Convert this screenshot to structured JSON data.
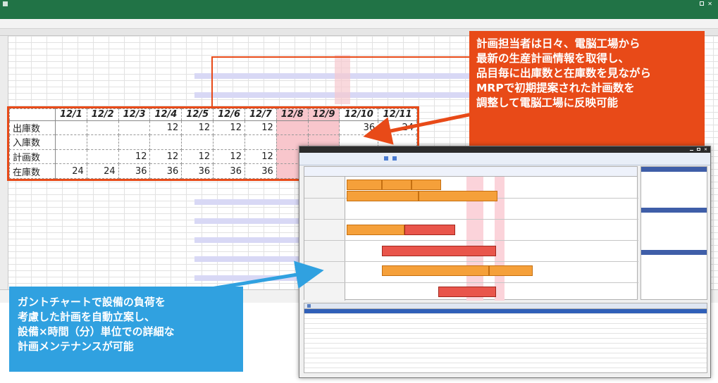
{
  "zoom_table": {
    "dates": [
      "12/1",
      "12/2",
      "12/3",
      "12/4",
      "12/5",
      "12/6",
      "12/7",
      "12/8",
      "12/9",
      "12/10",
      "12/11"
    ],
    "rows": [
      {
        "label": "出庫数",
        "values": [
          "",
          "",
          "",
          "12",
          "12",
          "12",
          "12",
          "",
          "",
          "36",
          "24"
        ]
      },
      {
        "label": "入庫数",
        "values": [
          "",
          "",
          "",
          "",
          "",
          "",
          "",
          "",
          "",
          "",
          ""
        ]
      },
      {
        "label": "計画数",
        "values": [
          "",
          "",
          "12",
          "12",
          "12",
          "12",
          "12",
          "",
          "",
          "",
          ""
        ]
      },
      {
        "label": "在庫数",
        "values": [
          "24",
          "24",
          "36",
          "36",
          "36",
          "36",
          "36",
          "",
          "",
          "",
          ""
        ]
      }
    ]
  },
  "callout_top": {
    "lines": [
      "計画担当者は日々、電脳工場から",
      "最新の生産計画情報を取得し、",
      "品目毎に出庫数と在庫数を見ながら",
      "MRPで初期提案された計画数を",
      "調整して電脳工場に反映可能"
    ],
    "color": "#e84a18"
  },
  "callout_bottom": {
    "lines": [
      "ガントチャートで設備の負荷を",
      "考慮した計画を自動立案し、",
      "設備×時間（分）単位での詳細な",
      "計画メンテナンスが可能"
    ],
    "color": "#30a1e0"
  },
  "colors": {
    "excel_green": "#217346",
    "plan_row": "#d8d8f5",
    "highlight_date": "#f8c6cc",
    "gantt_bar": "#f5a03a",
    "gantt_bar_alt": "#e9554b"
  },
  "icons": [
    "save-icon",
    "undo-icon",
    "search-icon",
    "close-icon",
    "minimize-icon",
    "maximize-icon",
    "filter-icon"
  ]
}
